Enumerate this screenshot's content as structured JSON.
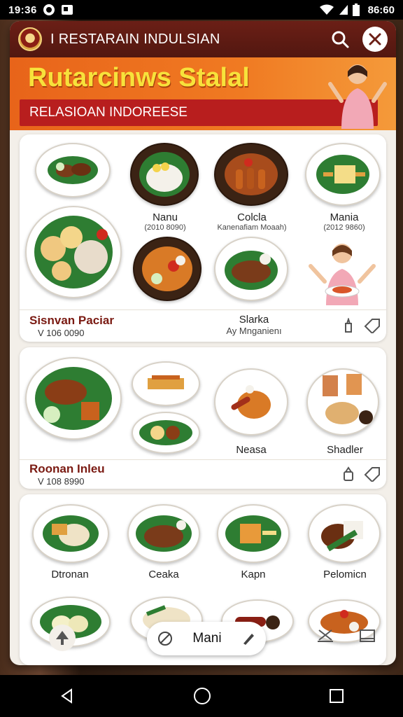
{
  "status": {
    "time": "19:36",
    "clock": "86:60"
  },
  "app": {
    "title": "I RESTARAIN INDULSIAN"
  },
  "banner": {
    "title": "Rutarcinws Stalal",
    "subtitle": "RELASIOAN INDOREESE"
  },
  "section1": {
    "dishes": [
      {
        "name": "Nanu",
        "price": "(2010 8090)"
      },
      {
        "name": "Colcla",
        "price": "Kanenafiam Moaah)"
      },
      {
        "name": "Mania",
        "price": "(2012 9860)"
      },
      {
        "name": "Slarka",
        "price": "Ay Mnganienı"
      }
    ],
    "category": {
      "name": "Sisnvan Paciar",
      "price": "V 106 0090"
    }
  },
  "section2": {
    "dishes": [
      {
        "name": "Neasa"
      },
      {
        "name": "Shadler"
      }
    ],
    "category": {
      "name": "Roonan Inleu",
      "price": "V 108 8990"
    }
  },
  "section3": {
    "dishes": [
      {
        "name": "Dtronan"
      },
      {
        "name": "Ceaka"
      },
      {
        "name": "Kapn"
      },
      {
        "name": "Pelomicn"
      }
    ]
  },
  "menu": {
    "label": "Mani"
  },
  "icons": {
    "search": "search-icon",
    "close": "close-icon",
    "back": "back-icon",
    "home": "home-icon",
    "recents": "recents-icon"
  },
  "colors": {
    "titlebar": "#6b1f16",
    "banner": "#f07a22",
    "banner_title": "#f7e23b",
    "subtitle_bar": "#b81e1e",
    "category": "#7a1a12"
  }
}
